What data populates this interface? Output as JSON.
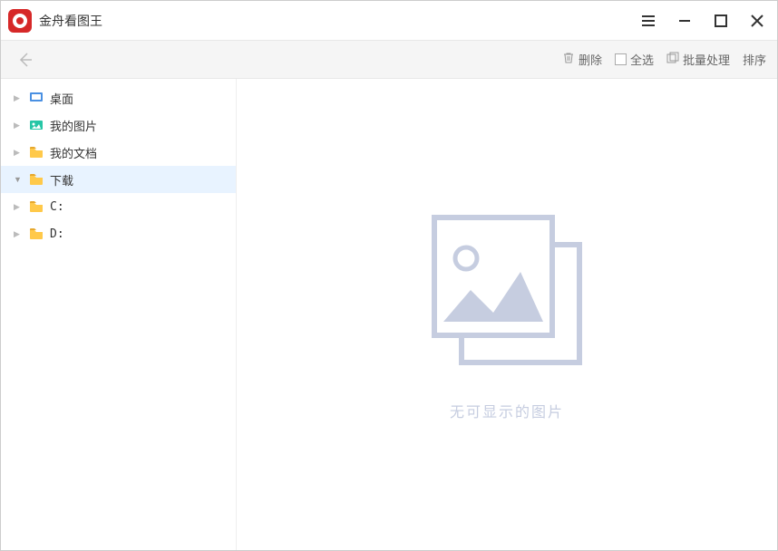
{
  "app": {
    "title": "金舟看图王"
  },
  "toolbar": {
    "delete": "删除",
    "selectAll": "全选",
    "batch": "批量处理",
    "sort": "排序"
  },
  "sidebar": {
    "items": [
      {
        "label": "桌面"
      },
      {
        "label": "我的图片"
      },
      {
        "label": "我的文档"
      },
      {
        "label": "下载"
      },
      {
        "label": "C:"
      },
      {
        "label": "D:"
      }
    ]
  },
  "main": {
    "emptyText": "无可显示的图片"
  }
}
